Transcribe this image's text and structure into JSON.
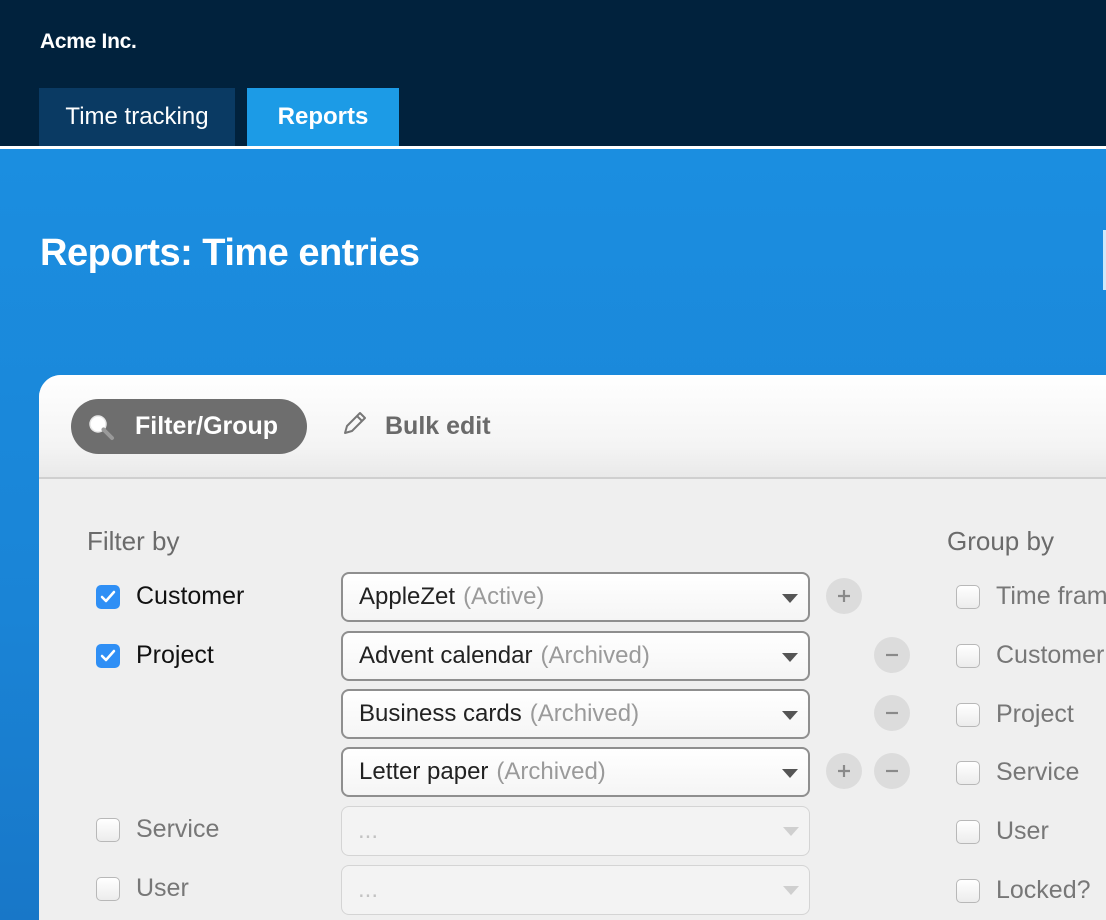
{
  "header": {
    "company": "Acme Inc.",
    "tabs": [
      {
        "label": "Time tracking",
        "active": false
      },
      {
        "label": "Reports",
        "active": true
      }
    ]
  },
  "page": {
    "title": "Reports: Time entries"
  },
  "toolbar": {
    "filter_group_label": "Filter/Group",
    "bulk_edit_label": "Bulk edit"
  },
  "filter": {
    "title": "Filter by",
    "rows": [
      {
        "label": "Customer",
        "checked": true,
        "value": "AppleZet",
        "status": "(Active)",
        "controls": [
          "plus"
        ]
      },
      {
        "label": "Project",
        "checked": true,
        "value": "Advent calendar",
        "status": "(Archived)",
        "controls": [
          "minus"
        ]
      },
      {
        "label": "",
        "checked": null,
        "value": "Business cards",
        "status": "(Archived)",
        "controls": [
          "minus"
        ]
      },
      {
        "label": "",
        "checked": null,
        "value": "Letter paper",
        "status": "(Archived)",
        "controls": [
          "plus",
          "minus"
        ]
      },
      {
        "label": "Service",
        "checked": false,
        "value": "...",
        "status": "",
        "controls": []
      },
      {
        "label": "User",
        "checked": false,
        "value": "...",
        "status": "",
        "controls": []
      }
    ]
  },
  "group": {
    "title": "Group by",
    "options": [
      {
        "label": "Time frame",
        "checked": false
      },
      {
        "label": "Customer",
        "checked": false
      },
      {
        "label": "Project",
        "checked": false
      },
      {
        "label": "Service",
        "checked": false
      },
      {
        "label": "User",
        "checked": false
      },
      {
        "label": "Locked?",
        "checked": false
      }
    ]
  },
  "colors": {
    "topbar": "#01223d",
    "active_tab": "#1c9be6",
    "hero": "#1a84d6",
    "checkbox_checked": "#2f8ff5"
  },
  "icons": [
    "search-icon",
    "pencil-icon",
    "caret-down-icon",
    "plus-icon",
    "minus-icon",
    "checkmark-icon"
  ]
}
